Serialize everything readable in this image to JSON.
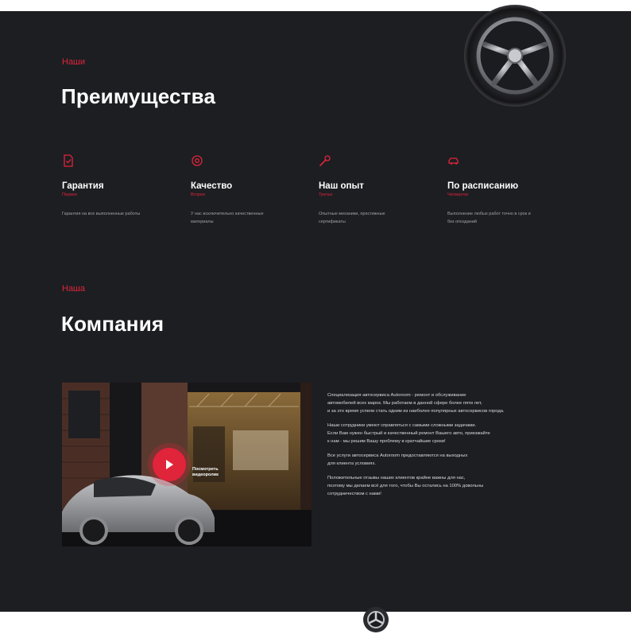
{
  "advantages": {
    "eyebrow": "Наши",
    "title": "Преимущества",
    "items": [
      {
        "icon": "document-check-icon",
        "title": "Гарантия",
        "subtitle": "Первое",
        "description": "Гарантия на все выполненные работы"
      },
      {
        "icon": "target-gear-icon",
        "title": "Качество",
        "subtitle": "Второе",
        "description": "У нас исключительно качественные материалы"
      },
      {
        "icon": "wrench-icon",
        "title": "Наш опыт",
        "subtitle": "Третье",
        "description": "Опытные механики, престижные сертификаты"
      },
      {
        "icon": "car-clock-icon",
        "title": "По расписанию",
        "subtitle": "Четвертое",
        "description": "Выполнение любых работ точно в срок и без опозданий"
      }
    ]
  },
  "company": {
    "eyebrow": "Наша",
    "title": "Компания",
    "video_label": "Посмотреть видеоролик",
    "paragraphs": [
      "Специализация автосервиса Autoroom - ремонт и обслуживание\nавтомобилей всех марок. Мы работаем в данной сфере более пяти лет,\nи за это время успели стать одним из наиболее популярных автосервисов города.",
      "Наши сотрудники умеют справляться с самыми сложными задачами.\nЕсли Вам нужен быстрый и качественный ремонт Вашего авто, приезжайте\nк нам - мы решим Вашу проблему в кратчайшие сроки!",
      "Все услуги автосервиса Autoroom предоставляются на выходных\nдля клиента условиях.",
      "Положительные отзывы наших клиентов крайне важны для нас,\nпоэтому мы делаем всё для того, чтобы Вы остались на 100% довольны\nсотрудничеством с нами!"
    ]
  },
  "colors": {
    "background": "#1d1e22",
    "accent": "#e0243a",
    "text_muted": "#9fa1a6"
  }
}
